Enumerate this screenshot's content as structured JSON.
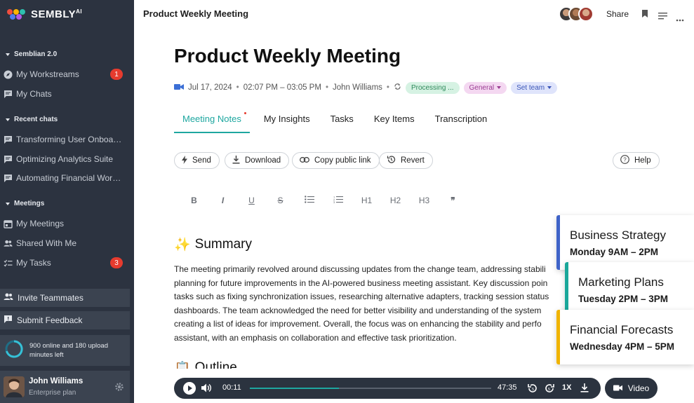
{
  "brand": {
    "name": "SEMBLY",
    "suffix": "AI"
  },
  "sidebar": {
    "sections": {
      "semblian": "Semblian 2.0",
      "recent": "Recent chats",
      "meetings": "Meetings"
    },
    "items": {
      "workstreams": {
        "label": "My Workstreams",
        "badge": "1"
      },
      "chats": {
        "label": "My Chats"
      },
      "recent1": {
        "label": "Transforming User Onboarding"
      },
      "recent2": {
        "label": "Optimizing Analytics Suite"
      },
      "recent3": {
        "label": "Automating Financial Workflo..."
      },
      "my_meetings": {
        "label": "My Meetings"
      },
      "shared": {
        "label": "Shared With Me"
      },
      "tasks": {
        "label": "My Tasks",
        "badge": "3"
      }
    },
    "invite_label": "Invite Teammates",
    "feedback_label": "Submit Feedback",
    "usage_text": "900 online and 180 upload minutes left",
    "user": {
      "name": "John Williams",
      "plan": "Enterprise plan"
    }
  },
  "topbar": {
    "title": "Product Weekly Meeting",
    "share_label": "Share"
  },
  "meeting": {
    "title": "Product Weekly Meeting",
    "date": "Jul 17, 2024",
    "time": "02:07 PM – 03:05 PM",
    "owner": "John Williams",
    "status_chip": "Processing ...",
    "category_chip": "General",
    "team_chip": "Set team"
  },
  "tabs": [
    "Meeting Notes",
    "My Insights",
    "Tasks",
    "Key Items",
    "Transcription"
  ],
  "actions": {
    "send": "Send",
    "download": "Download",
    "copy_link": "Copy public link",
    "revert": "Revert",
    "help": "Help"
  },
  "format_toolbar": [
    "B",
    "I",
    "U",
    "S",
    "•",
    "1.",
    "H1",
    "H2",
    "H3",
    "❞"
  ],
  "summary": {
    "emoji": "✨",
    "title": "Summary",
    "lines": [
      "The meeting primarily revolved around discussing updates from the change team, addressing stabili",
      "planning for future improvements in the AI-powered business meeting assistant. Key discussion poin",
      "tasks such as fixing synchronization issues, researching alternative adapters, tracking session status",
      "dashboards. The team acknowledged the need for better visibility and understanding of the system",
      "creating a list of ideas for improvement. Overall, the focus was on enhancing the stability and perfo",
      "assistant, with an emphasis on collaboration and effective task prioritization."
    ]
  },
  "outline": {
    "emoji": "📋",
    "title": "Outline"
  },
  "player": {
    "current": "00:11",
    "total": "47:35",
    "speed": "1X",
    "progress": 0.37,
    "video_label": "Video"
  },
  "cards": [
    {
      "title": "Business Strategy",
      "subtitle": "Monday 9AM – 2PM",
      "color": "#3f63c8"
    },
    {
      "title": "Marketing Plans",
      "subtitle": "Tuesday 2PM – 3PM",
      "color": "#1aa79a"
    },
    {
      "title": "Financial Forecasts",
      "subtitle": "Wednesday 4PM – 5PM",
      "color": "#f0b400"
    }
  ],
  "colors": {
    "sidebar_bg": "#2c3340",
    "accent": "#1ea7a0",
    "badge": "#e63b2e",
    "chip_processing": "#d6f2e3",
    "chip_general": "#f4d8f1",
    "chip_team": "#dfe4fb"
  }
}
